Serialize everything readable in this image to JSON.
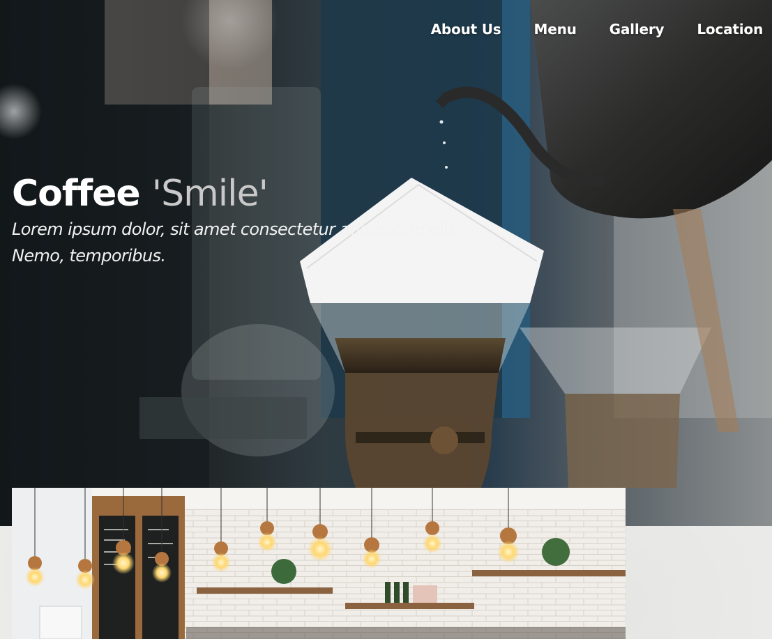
{
  "nav": {
    "items": [
      {
        "label": "About Us"
      },
      {
        "label": "Menu"
      },
      {
        "label": "Gallery"
      },
      {
        "label": "Location"
      }
    ]
  },
  "hero": {
    "title_strong": "Coffee",
    "title_light": "'Smile'",
    "tagline_line1": "Lorem ipsum dolor, sit amet consectetur adipisicing elit.",
    "tagline_line2": "Nemo, temporibus."
  },
  "colors": {
    "nav_text": "#ffffff",
    "title_strong": "#ffffff",
    "title_light": "#c9c9c9",
    "page_background": "#efefed"
  },
  "images": {
    "hero": "pour-over-coffee-photo",
    "gallery": "cafe-interior-pendant-lights-photo"
  }
}
